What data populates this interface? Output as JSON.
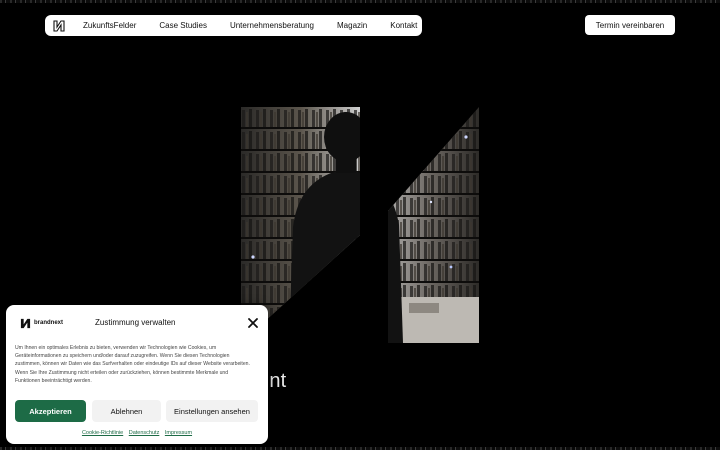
{
  "nav": {
    "logo_icon": "brandnext-logo-icon",
    "items": [
      "ZukunftsFelder",
      "Case Studies",
      "Unternehmensberatung",
      "Magazin",
      "Kontakt"
    ],
    "cta_label": "Termin vereinbaren"
  },
  "hero": {
    "partial_text": "nnt",
    "image_subject": "person-in-library-corridor"
  },
  "consent": {
    "brand_name": "brandnext",
    "title": "Zustimmung verwalten",
    "close_icon": "close-icon",
    "body": "Um Ihnen ein optimales Erlebnis zu bieten, verwenden wir Technologien wie Cookies, um Geräteinformationen zu speichern und/oder darauf zuzugreifen. Wenn Sie diesen Technologien zustimmen, können wir Daten wie das Surfverhalten oder eindeutige IDs auf dieser Website verarbeiten. Wenn Sie Ihre Zustimmung nicht erteilen oder zurückziehen, können bestimmte Merkmale und Funktionen beeinträchtigt werden.",
    "accept_label": "Akzeptieren",
    "decline_label": "Ablehnen",
    "settings_label": "Einstellungen ansehen",
    "links": [
      "Cookie-Richtlinie",
      "Datenschutz",
      "Impressum"
    ]
  },
  "colors": {
    "background": "#000000",
    "accept": "#1d6b46"
  }
}
